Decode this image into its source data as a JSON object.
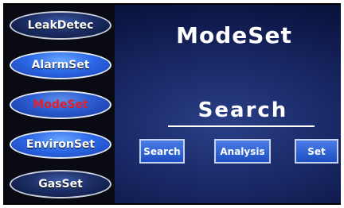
{
  "sidebar": {
    "items": [
      {
        "label": "LeakDetec"
      },
      {
        "label": "AlarmSet"
      },
      {
        "label": "ModeSet"
      },
      {
        "label": "EnvironSet"
      },
      {
        "label": "GasSet"
      }
    ],
    "active": "ModeSet"
  },
  "main": {
    "title": "ModeSet",
    "current_mode": "Search",
    "buttons": [
      {
        "label": "Search"
      },
      {
        "label": "Analysis"
      },
      {
        "label": "Set"
      }
    ]
  },
  "colors": {
    "active_text": "#e3202a",
    "background": "#1a2a68",
    "button": "#2c6ae8"
  }
}
